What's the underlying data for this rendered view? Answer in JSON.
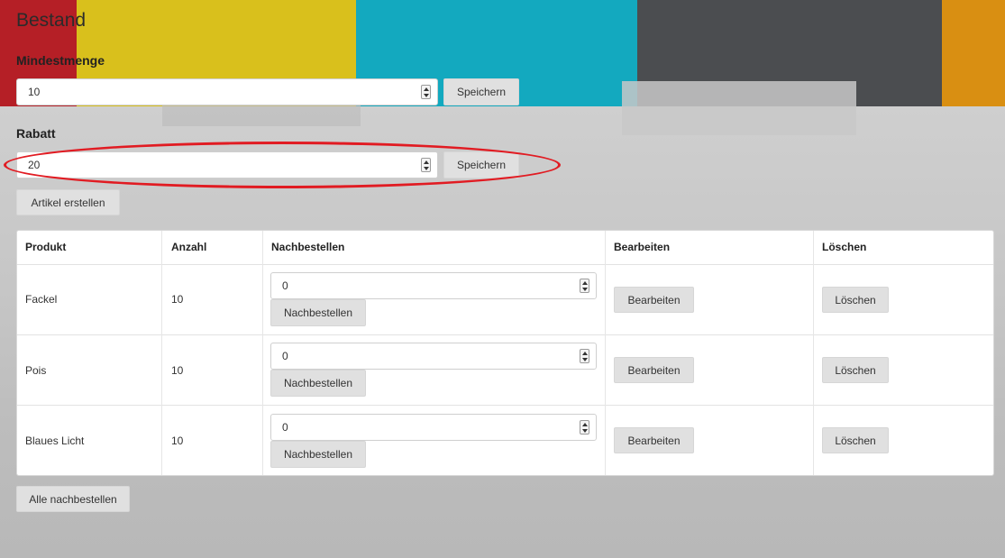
{
  "page": {
    "title": "Bestand"
  },
  "mindestmenge": {
    "label": "Mindestmenge",
    "value": "10",
    "save_label": "Speichern"
  },
  "rabatt": {
    "label": "Rabatt",
    "value": "20",
    "save_label": "Speichern"
  },
  "create_article_label": "Artikel erstellen",
  "table": {
    "headers": [
      "Produkt",
      "Anzahl",
      "Nachbestellen",
      "Bearbeiten",
      "Löschen"
    ],
    "rows": [
      {
        "product": "Fackel",
        "count": "10",
        "reorder_value": "0",
        "reorder_label": "Nachbestellen",
        "edit_label": "Bearbeiten",
        "delete_label": "Löschen"
      },
      {
        "product": "Pois",
        "count": "10",
        "reorder_value": "0",
        "reorder_label": "Nachbestellen",
        "edit_label": "Bearbeiten",
        "delete_label": "Löschen"
      },
      {
        "product": "Blaues Licht",
        "count": "10",
        "reorder_value": "0",
        "reorder_label": "Nachbestellen",
        "edit_label": "Bearbeiten",
        "delete_label": "Löschen"
      }
    ]
  },
  "reorder_all_label": "Alle nachbestellen",
  "annotation": {
    "color": "#e11b22"
  },
  "colors": {
    "red": "#b51f26",
    "yellow": "#d9c01c",
    "cyan": "#13a9bf",
    "dark": "#4b4d50",
    "orange": "#d98f12"
  }
}
